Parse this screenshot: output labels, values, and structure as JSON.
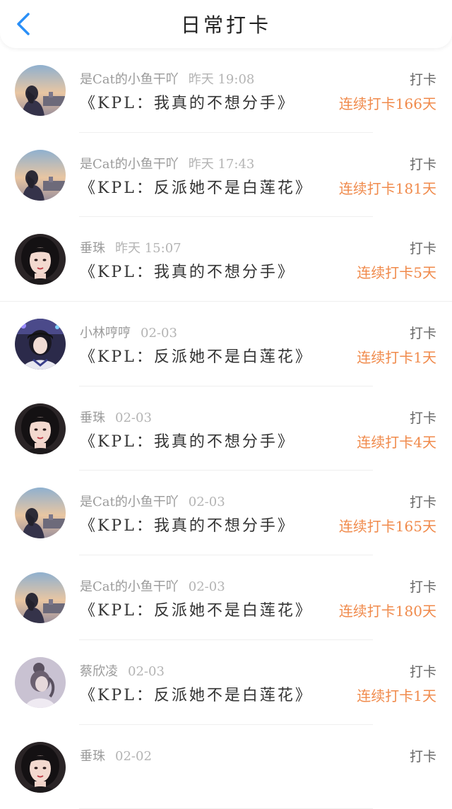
{
  "header": {
    "title": "日常打卡",
    "back_icon": "chevron-left-icon",
    "accent_color": "#2a8ff7"
  },
  "streak_color": "#f08a4b",
  "entries": [
    {
      "user": "是Cat的小鱼干吖",
      "time": "昨天 19:08",
      "book": "《KPL：我真的不想分手》",
      "action": "打卡",
      "streak": "连续打卡166天",
      "avatar": "sunset-girl"
    },
    {
      "user": "是Cat的小鱼干吖",
      "time": "昨天 17:43",
      "book": "《KPL：反派她不是白莲花》",
      "action": "打卡",
      "streak": "连续打卡181天",
      "avatar": "sunset-girl"
    },
    {
      "user": "垂珠",
      "time": "昨天 15:07",
      "book": "《KPL：我真的不想分手》",
      "action": "打卡",
      "streak": "连续打卡5天",
      "avatar": "dark-hair-girl"
    },
    {
      "user": "小林哼哼",
      "time": "02-03",
      "book": "《KPL：反派她不是白莲花》",
      "action": "打卡",
      "streak": "连续打卡1天",
      "avatar": "gamer-girl"
    },
    {
      "user": "垂珠",
      "time": "02-03",
      "book": "《KPL：我真的不想分手》",
      "action": "打卡",
      "streak": "连续打卡4天",
      "avatar": "dark-hair-girl"
    },
    {
      "user": "是Cat的小鱼干吖",
      "time": "02-03",
      "book": "《KPL：我真的不想分手》",
      "action": "打卡",
      "streak": "连续打卡165天",
      "avatar": "sunset-girl"
    },
    {
      "user": "是Cat的小鱼干吖",
      "time": "02-03",
      "book": "《KPL：反派她不是白莲花》",
      "action": "打卡",
      "streak": "连续打卡180天",
      "avatar": "sunset-girl"
    },
    {
      "user": "蔡欣凌",
      "time": "02-03",
      "book": "《KPL：反派她不是白莲花》",
      "action": "打卡",
      "streak": "连续打卡1天",
      "avatar": "bun-hair-girl"
    },
    {
      "user": "垂珠",
      "time": "02-02",
      "book": "",
      "action": "打卡",
      "streak": "",
      "avatar": "dark-hair-girl"
    }
  ]
}
